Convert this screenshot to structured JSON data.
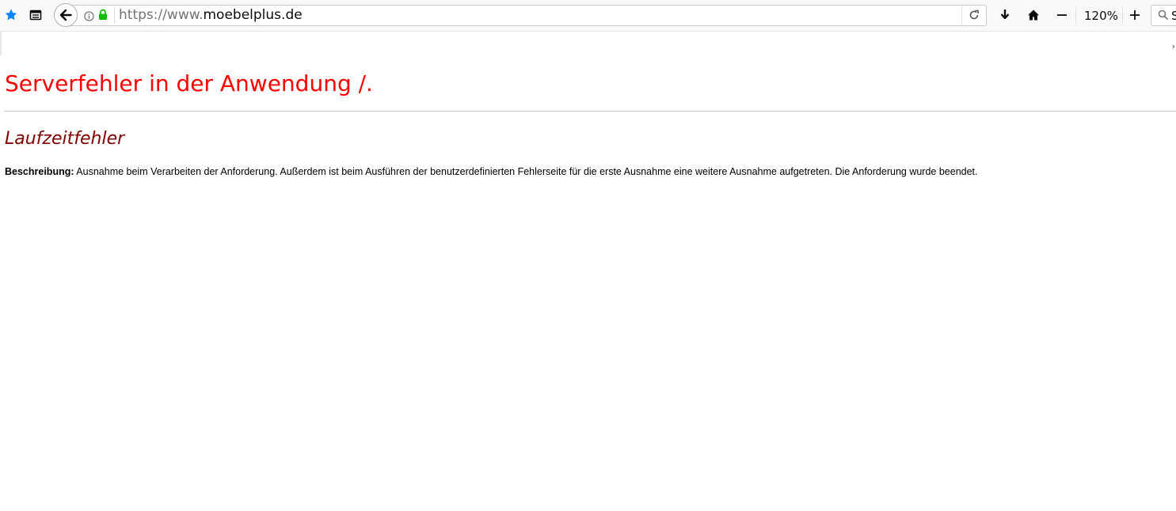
{
  "browser": {
    "url_prefix": "https://www.",
    "url_host": "moebelplus.de",
    "zoom": "120%",
    "search_placeholder_visible": "S",
    "icons": [
      "bookmark-star-icon",
      "reader-view-icon",
      "back-arrow-icon",
      "info-icon",
      "lock-icon",
      "reload-icon",
      "download-icon",
      "home-icon",
      "zoom-out-icon",
      "zoom-in-icon",
      "search-icon"
    ],
    "colors": {
      "star": "#0a84ff",
      "lock": "#12bc00"
    }
  },
  "page": {
    "title": "Serverfehler in der Anwendung /.",
    "subtitle": "Laufzeitfehler",
    "description_label": "Beschreibung:",
    "description_text": " Ausnahme beim Verarbeiten der Anforderung. Außerdem ist beim Ausführen der benutzerdefinierten Fehlerseite für die erste Ausnahme eine weitere Ausnahme aufgetreten. Die Anforderung wurde beendet.",
    "colors": {
      "title": "#ff0000",
      "subtitle": "#800000"
    }
  }
}
